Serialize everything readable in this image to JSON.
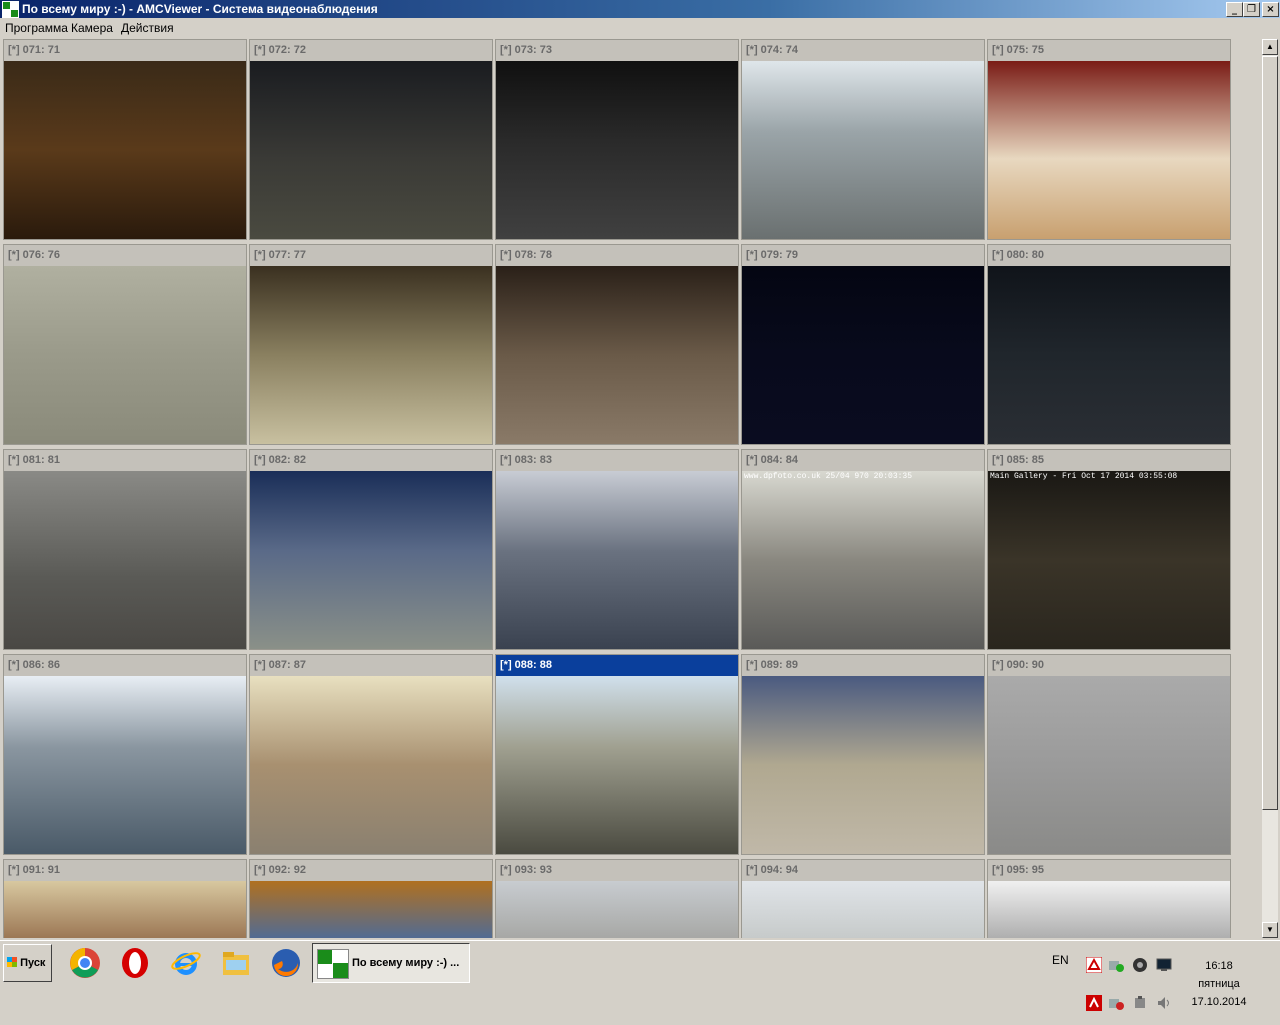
{
  "window": {
    "title": "По всему миру :-) - AMCViewer - Система видеонаблюдения",
    "controls": {
      "minimize": "_",
      "restore": "❐",
      "close": "×"
    }
  },
  "menu": [
    "Программа",
    "Камера",
    "Действия"
  ],
  "cameras": [
    {
      "label": "[*] 071: 71"
    },
    {
      "label": "[*] 072: 72"
    },
    {
      "label": "[*] 073: 73"
    },
    {
      "label": "[*] 074: 74"
    },
    {
      "label": "[*] 075: 75"
    },
    {
      "label": "[*] 076: 76"
    },
    {
      "label": "[*] 077: 77"
    },
    {
      "label": "[*] 078: 78"
    },
    {
      "label": "[*] 079: 79"
    },
    {
      "label": "[*] 080: 80"
    },
    {
      "label": "[*] 081: 81"
    },
    {
      "label": "[*] 082: 82"
    },
    {
      "label": "[*] 083: 83"
    },
    {
      "label": "[*] 084: 84",
      "overlay": "www.dpfoto.co.uk 25/04 970 20:03:35"
    },
    {
      "label": "[*] 085: 85",
      "overlay": "Main Gallery  -  Fri Oct 17 2014 03:55:08"
    },
    {
      "label": "[*] 086: 86"
    },
    {
      "label": "[*] 087: 87"
    },
    {
      "label": "[*] 088: 88",
      "active": true
    },
    {
      "label": "[*] 089: 89"
    },
    {
      "label": "[*] 090: 90"
    },
    {
      "label": "[*] 091: 91"
    },
    {
      "label": "[*] 092: 92"
    },
    {
      "label": "[*] 093: 93"
    },
    {
      "label": "[*] 094: 94"
    },
    {
      "label": "[*] 095: 95"
    }
  ],
  "taskbar": {
    "start_label": "Пуск",
    "pinned": [
      "chrome-icon",
      "opera-icon",
      "internet-explorer-icon",
      "file-explorer-icon",
      "firefox-icon"
    ],
    "active_task": "По всему миру :-) ...",
    "language": "EN",
    "clock": {
      "time": "16:18",
      "weekday": "пятница",
      "date": "17.10.2014"
    }
  },
  "colors": {
    "titlebar": "#0a246a",
    "active_camera_header": "#0a3f9c",
    "face": "#d4d0c8"
  }
}
